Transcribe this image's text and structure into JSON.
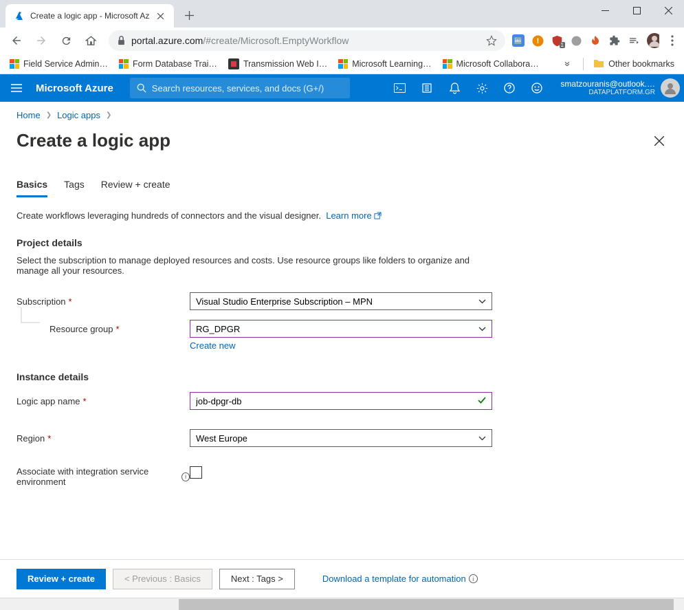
{
  "browser": {
    "tab_title": "Create a logic app - Microsoft Az",
    "url_host": "portal.azure.com",
    "url_path": "/#create/Microsoft.EmptyWorkflow",
    "bookmarks": [
      "Field Service Admin…",
      "Form Database Trai…",
      "Transmission Web I…",
      "Microsoft Learning…",
      "Microsoft Collabora…"
    ],
    "other_bookmarks": "Other bookmarks"
  },
  "azure_bar": {
    "brand": "Microsoft Azure",
    "search_placeholder": "Search resources, services, and docs (G+/)",
    "email": "smatzouranis@outlook.…",
    "org": "DATAPLATFORM.GR"
  },
  "breadcrumb": {
    "home": "Home",
    "logic_apps": "Logic apps"
  },
  "page": {
    "title": "Create a logic app",
    "tabs": {
      "basics": "Basics",
      "tags": "Tags",
      "review": "Review + create"
    },
    "description": "Create workflows leveraging hundreds of connectors and the visual designer.",
    "learn_more": "Learn more",
    "project_details": {
      "heading": "Project details",
      "description": "Select the subscription to manage deployed resources and costs. Use resource groups like folders to organize and manage all your resources.",
      "subscription_label": "Subscription",
      "subscription_value": "Visual Studio Enterprise Subscription – MPN",
      "rg_label": "Resource group",
      "rg_value": "RG_DPGR",
      "create_new": "Create new"
    },
    "instance_details": {
      "heading": "Instance details",
      "name_label": "Logic app name",
      "name_value": "job-dpgr-db",
      "region_label": "Region",
      "region_value": "West Europe",
      "ise_label": "Associate with integration service environment"
    }
  },
  "footer": {
    "review": "Review + create",
    "previous": "< Previous : Basics",
    "next": "Next : Tags >",
    "download": "Download a template for automation"
  }
}
